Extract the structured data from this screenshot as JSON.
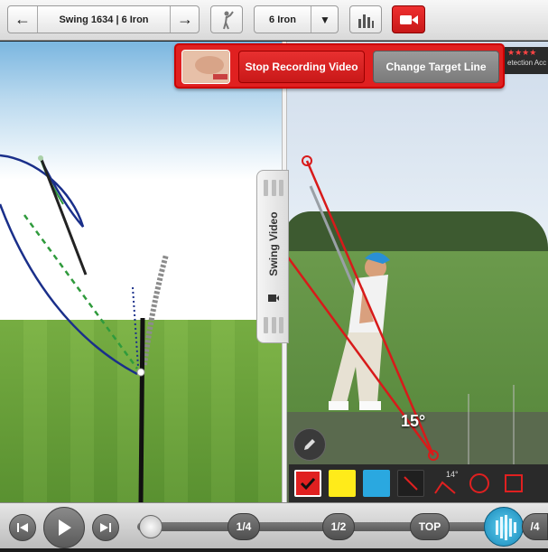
{
  "toolbar": {
    "prev_swing": "←",
    "swing_title": "Swing 1634 | 6 Iron",
    "next_swing": "→",
    "club_selector": "6 Iron",
    "club_dropdown": "▼"
  },
  "recording": {
    "stop_label": "Stop Recording Video",
    "change_target_label": "Change Target Line"
  },
  "ratings": {
    "stars": "★★★★",
    "caption": "etection Acc"
  },
  "video_tab": {
    "label": "Swing Video"
  },
  "overlay": {
    "angle_label": "15°",
    "line_angle_badge": "14°"
  },
  "palette": {
    "colors": [
      "#e02020",
      "#ffeb1a",
      "#2aa8e0",
      "#2a2a2a"
    ]
  },
  "timeline": {
    "marker_quarter": "1/4",
    "marker_half": "1/2",
    "marker_top": "TOP",
    "marker_right": "/4"
  },
  "theme": {
    "accent_red": "#e02020",
    "swing_path_blue": "#1a2f8a",
    "target_line_green": "#2f9a3c"
  }
}
